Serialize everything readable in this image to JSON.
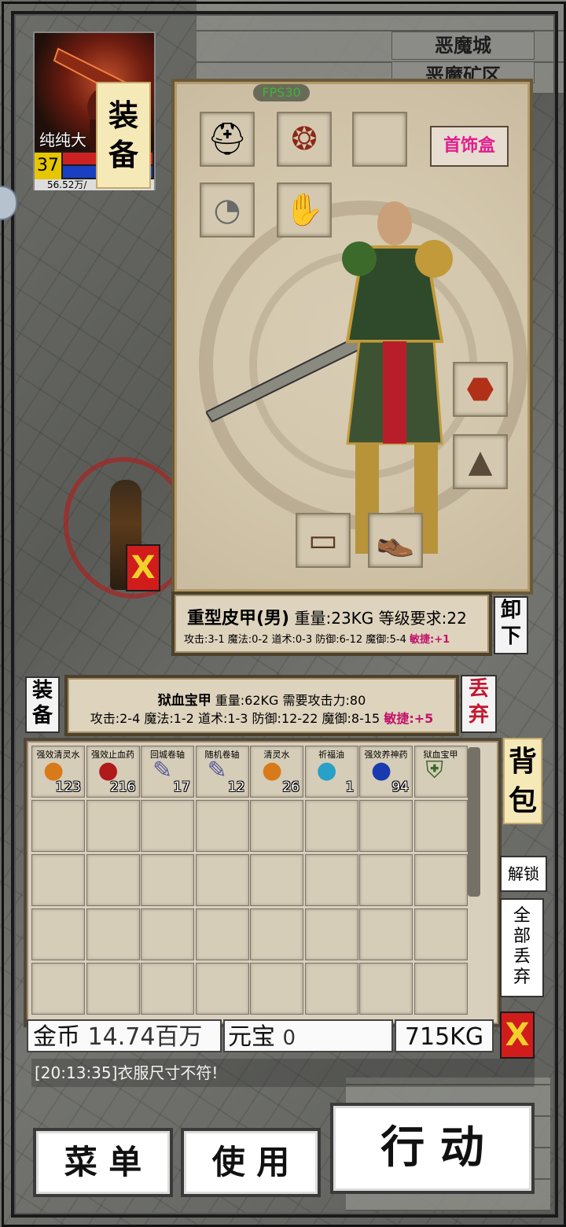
{
  "location": {
    "city": "恶魔城",
    "area": "恶魔矿区"
  },
  "player": {
    "name": "纯纯大",
    "level": "37",
    "hp": "48",
    "mp": "11",
    "exp": "56.52万/"
  },
  "tabs": {
    "equip_vertical": [
      "装",
      "备"
    ],
    "bag_vertical": [
      "背",
      "包"
    ],
    "equip_small": [
      "装",
      "备"
    ]
  },
  "panel": {
    "fps": "FPS30",
    "jewelry_box": "首饰盒"
  },
  "equipped_item": {
    "name": "重型皮甲(男)",
    "meta": " 重量:23KG 等级要求:22",
    "stats": "攻击:3-1 魔法:0-2 道术:0-3 防御:6-12 魔御:5-4 ",
    "agility": "敏捷:+1",
    "button": [
      "卸",
      "下"
    ]
  },
  "selected_item": {
    "name": "狱血宝甲",
    "meta": " 重量:62KG 需要攻击力:80",
    "stats": "攻击:2-4 魔法:1-2 道术:1-3 防御:12-22 魔御:8-15 ",
    "agility": "敏捷:+5",
    "button": [
      "丢",
      "弃"
    ]
  },
  "bag_items": [
    {
      "name": "强效清灵水",
      "count": "123",
      "icon": "orange-potion-icon"
    },
    {
      "name": "强效止血药",
      "count": "216",
      "icon": "red-pouch-icon"
    },
    {
      "name": "回城卷轴",
      "count": "17",
      "icon": "scroll-icon"
    },
    {
      "name": "随机卷轴",
      "count": "12",
      "icon": "scroll-icon"
    },
    {
      "name": "清灵水",
      "count": "26",
      "icon": "orange-potion-icon"
    },
    {
      "name": "祈福油",
      "count": "1",
      "icon": "blue-flask-icon"
    },
    {
      "name": "强效养神药",
      "count": "94",
      "icon": "blue-pouch-icon"
    },
    {
      "name": "狱血宝甲",
      "count": "",
      "icon": "armor-icon"
    }
  ],
  "currency": {
    "gold_label": "金币",
    "gold_value": "14.74百万",
    "yuanbao_label": "元宝",
    "yuanbao_value": "0",
    "weight": "715KG"
  },
  "side_buttons": {
    "unlock": "解锁",
    "discard_all": [
      "全",
      "部",
      "丢",
      "弃"
    ]
  },
  "close_label": "X",
  "message": "[20:13:35]衣服尺寸不符!",
  "bottom": {
    "menu": "菜 单",
    "use": "使 用",
    "action": "行 动"
  }
}
